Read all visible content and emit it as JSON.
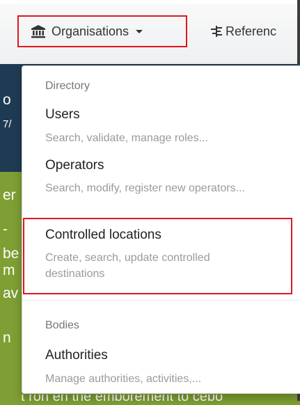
{
  "nav": {
    "organisations": {
      "label": "Organisations",
      "icon": "bank-icon"
    },
    "references": {
      "label": "Referenc",
      "icon": "hierarchy-icon"
    }
  },
  "background": {
    "letters": [
      "o",
      "7/",
      "er",
      "- ",
      "be",
      "m",
      "av",
      "n"
    ],
    "partial_line": "t ron en the emborement to cebo"
  },
  "dropdown": {
    "directory_header": "Directory",
    "bodies_header": "Bodies",
    "items": [
      {
        "title": "Users",
        "description": "Search, validate, manage roles..."
      },
      {
        "title": "Operators",
        "description": "Search, modify, register new operators..."
      },
      {
        "title": "Controlled locations",
        "description": "Create, search, update controlled destinations"
      },
      {
        "title": "Authorities",
        "description": "Manage authorities, activities,..."
      }
    ]
  },
  "colors": {
    "highlight": "#e0161e",
    "header_band": "#1f3b53",
    "content_band": "#7e9f33"
  }
}
